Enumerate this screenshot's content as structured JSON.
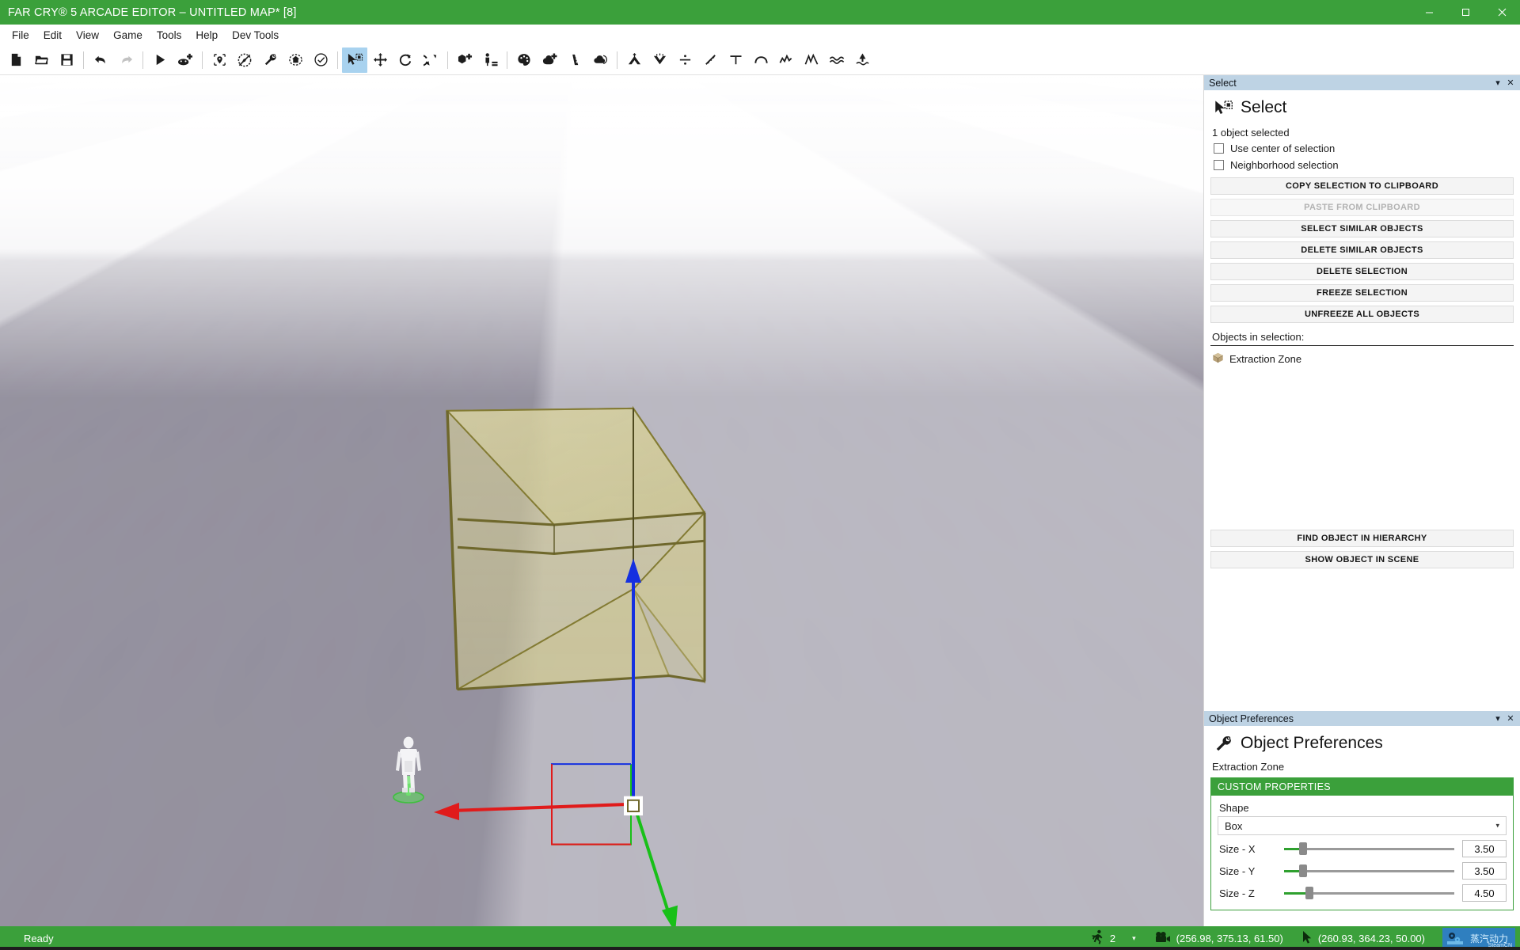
{
  "window": {
    "title": "FAR CRY® 5 ARCADE EDITOR – UNTITLED MAP* [8]",
    "minimize": "—",
    "maximize": "▢",
    "close": "✕"
  },
  "menubar": {
    "items": [
      {
        "label": "File"
      },
      {
        "label": "Edit"
      },
      {
        "label": "View"
      },
      {
        "label": "Game"
      },
      {
        "label": "Tools"
      },
      {
        "label": "Help"
      },
      {
        "label": "Dev Tools"
      }
    ]
  },
  "toolbar": {
    "groups": [
      {
        "buttons": [
          {
            "name": "new-map-icon",
            "label": "New"
          },
          {
            "name": "open-map-icon",
            "label": "Open"
          },
          {
            "name": "save-map-icon",
            "label": "Save"
          }
        ]
      },
      {
        "buttons": [
          {
            "name": "undo-icon",
            "label": "Undo"
          },
          {
            "name": "redo-icon",
            "label": "Redo",
            "disabled": true
          }
        ]
      },
      {
        "buttons": [
          {
            "name": "play-icon",
            "label": "Play Map"
          },
          {
            "name": "add-gamepad-icon",
            "label": "Add Player Test"
          }
        ]
      },
      {
        "buttons": [
          {
            "name": "map-marker-icon",
            "label": "Map Bounds"
          },
          {
            "name": "no-compass-icon",
            "label": "Toggle Compass"
          },
          {
            "name": "wrench-icon",
            "label": "Object Preferences"
          },
          {
            "name": "building-icon",
            "label": "Building Tool"
          },
          {
            "name": "validate-check-icon",
            "label": "Validate Map"
          }
        ]
      },
      {
        "buttons": [
          {
            "name": "select-cursor-icon",
            "label": "Select",
            "active": true
          },
          {
            "name": "move-arrows-icon",
            "label": "Move"
          },
          {
            "name": "rotate-icon",
            "label": "Rotate"
          },
          {
            "name": "scale-icon",
            "label": "Scale"
          }
        ]
      },
      {
        "buttons": [
          {
            "name": "add-object-icon",
            "label": "Add Object"
          },
          {
            "name": "add-character-icon",
            "label": "Add Character"
          }
        ]
      },
      {
        "buttons": [
          {
            "name": "palette-icon",
            "label": "Terrain Paint"
          },
          {
            "name": "add-tree-icon",
            "label": "Add Vegetation"
          },
          {
            "name": "road-icon",
            "label": "Road Tool"
          },
          {
            "name": "weather-icon",
            "label": "Weather"
          }
        ]
      },
      {
        "buttons": [
          {
            "name": "terrain-raise-icon",
            "label": "Raise Terrain"
          },
          {
            "name": "terrain-lower-icon",
            "label": "Lower Terrain"
          },
          {
            "name": "terrain-smooth-icon",
            "label": "Smooth Terrain"
          },
          {
            "name": "terrain-slope-icon",
            "label": "Slope"
          },
          {
            "name": "terrain-flatten-icon",
            "label": "Flatten"
          },
          {
            "name": "terrain-hill-icon",
            "label": "Hill"
          },
          {
            "name": "terrain-ridge-icon",
            "label": "Ridge"
          },
          {
            "name": "terrain-noise-icon",
            "label": "Noise"
          },
          {
            "name": "water-waves-icon",
            "label": "Water"
          },
          {
            "name": "water-level-icon",
            "label": "Water Level"
          }
        ]
      }
    ]
  },
  "viewport": {
    "name": "3d-viewport",
    "selected_object_label": "Extraction Zone",
    "gizmo": {
      "x_axis_color": "#e01b1b",
      "y_axis_color": "#18c018",
      "z_axis_color": "#1530e0"
    },
    "box_color": "#cdc68e",
    "box_edge_color": "#8a8238",
    "ground_color": "#e9e8ec",
    "ground_tile_color": "#a29eac"
  },
  "select_panel": {
    "caption": "Select",
    "caption_collapse": "▾",
    "caption_close": "✕",
    "heading": "Select",
    "heading_icon": "select-cursor-icon",
    "selection_count": "1 object selected",
    "checkboxes": [
      {
        "label": "Use center of selection",
        "checked": false
      },
      {
        "label": "Neighborhood selection",
        "checked": false
      }
    ],
    "buttons": [
      {
        "label": "COPY SELECTION TO CLIPBOARD",
        "disabled": false
      },
      {
        "label": "PASTE FROM CLIPBOARD",
        "disabled": true
      },
      {
        "label": "SELECT SIMILAR OBJECTS",
        "disabled": false
      },
      {
        "label": "DELETE SIMILAR OBJECTS",
        "disabled": false
      },
      {
        "label": "DELETE SELECTION",
        "disabled": false
      },
      {
        "label": "FREEZE SELECTION",
        "disabled": false
      },
      {
        "label": "UNFREEZE ALL OBJECTS",
        "disabled": false
      }
    ],
    "objects_label": "Objects in selection:",
    "objects": [
      {
        "label": "Extraction Zone",
        "icon": "box-object-icon"
      }
    ],
    "bottom_buttons": [
      {
        "label": "FIND OBJECT IN HIERARCHY"
      },
      {
        "label": "SHOW OBJECT IN SCENE"
      }
    ]
  },
  "object_preferences": {
    "caption": "Object Preferences",
    "caption_collapse": "▾",
    "caption_close": "✕",
    "heading": "Object Preferences",
    "heading_icon": "wrench-icon",
    "object_name": "Extraction Zone",
    "section_title": "CUSTOM PROPERTIES",
    "shape_label": "Shape",
    "shape_value": "Box",
    "shape_caret": "▾",
    "sliders": [
      {
        "label": "Size - X",
        "value": "3.50",
        "percent": 11
      },
      {
        "label": "Size - Y",
        "value": "3.50",
        "percent": 11
      },
      {
        "label": "Size - Z",
        "value": "4.50",
        "percent": 15
      }
    ]
  },
  "statusbar": {
    "ready": "Ready",
    "player_count": "2",
    "player_caret": "▾",
    "player_icon": "running-man-icon",
    "camera_icon": "camera-icon",
    "camera_coords": "(256.98, 375.13, 61.50)",
    "cursor_icon": "cursor-arrow-icon",
    "cursor_coords": "(260.93, 364.23, 50.00)",
    "watermark_text": "蒸汽动力",
    "watermark_sub": "SteamCN"
  },
  "colors": {
    "brand_green": "#3ba03b",
    "caption_blue": "#bed3e4",
    "toolbar_active": "#a8d2ef"
  }
}
